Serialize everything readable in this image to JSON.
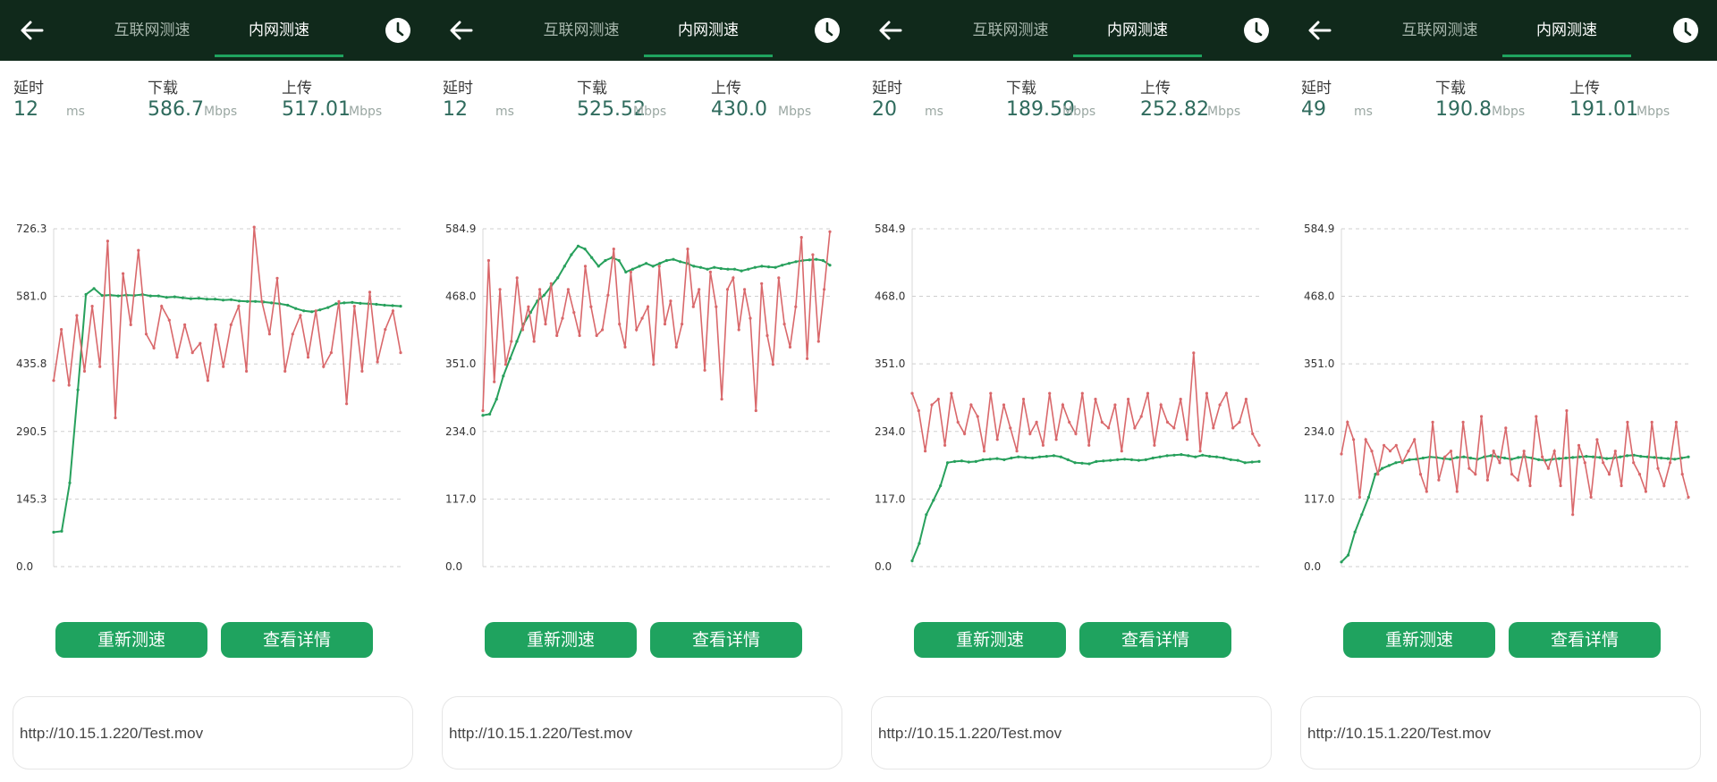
{
  "panels": [
    {
      "tabs": [
        "互联网测速",
        "内网测速"
      ],
      "latency": {
        "label": "延时",
        "value": "12",
        "unit": "ms"
      },
      "download": {
        "label": "下载",
        "value": "586.7",
        "unit": "Mbps"
      },
      "upload": {
        "label": "上传",
        "value": "517.01",
        "unit": "Mbps"
      },
      "retest_label": "重新测速",
      "details_label": "查看详情",
      "url": "http://10.15.1.220/Test.mov"
    },
    {
      "tabs": [
        "互联网测速",
        "内网测速"
      ],
      "latency": {
        "label": "延时",
        "value": "12",
        "unit": "ms"
      },
      "download": {
        "label": "下载",
        "value": "525.52",
        "unit": "Mbps"
      },
      "upload": {
        "label": "上传",
        "value": "430.0",
        "unit": "Mbps"
      },
      "retest_label": "重新测速",
      "details_label": "查看详情",
      "url": "http://10.15.1.220/Test.mov"
    },
    {
      "tabs": [
        "互联网测速",
        "内网测速"
      ],
      "latency": {
        "label": "延时",
        "value": "20",
        "unit": "ms"
      },
      "download": {
        "label": "下载",
        "value": "189.59",
        "unit": "Mbps"
      },
      "upload": {
        "label": "上传",
        "value": "252.82",
        "unit": "Mbps"
      },
      "retest_label": "重新测速",
      "details_label": "查看详情",
      "url": "http://10.15.1.220/Test.mov"
    },
    {
      "tabs": [
        "互联网测速",
        "内网测速"
      ],
      "latency": {
        "label": "延时",
        "value": "49",
        "unit": "ms"
      },
      "download": {
        "label": "下载",
        "value": "190.8",
        "unit": "Mbps"
      },
      "upload": {
        "label": "上传",
        "value": "191.01",
        "unit": "Mbps"
      },
      "retest_label": "重新测速",
      "details_label": "查看详情",
      "url": "http://10.15.1.220/Test.mov"
    }
  ],
  "icons": {
    "back": "arrow-left-icon",
    "history": "clock-icon"
  },
  "colors": {
    "topbar": "#10291b",
    "accent": "#1fa35f",
    "download_line": "#27a05c",
    "upload_line": "#d9686b"
  },
  "chart_data": [
    {
      "type": "line",
      "yticks": [
        "726.3",
        "581.0",
        "435.8",
        "290.5",
        "145.3",
        "0.0"
      ],
      "ylim": [
        0,
        726.3
      ],
      "grid": true,
      "series": [
        {
          "values": [
            74,
            76,
            180,
            380,
            585,
            598,
            583,
            584,
            582,
            584,
            583,
            585,
            582,
            582,
            579,
            580,
            578,
            576,
            577,
            575,
            575,
            573,
            574,
            571,
            570,
            570,
            569,
            567,
            565,
            562,
            555,
            550,
            548,
            552,
            557,
            565,
            567,
            568,
            566,
            565,
            564,
            562,
            561,
            560
          ]
        },
        {
          "values": [
            400,
            510,
            390,
            540,
            420,
            560,
            430,
            700,
            320,
            630,
            520,
            680,
            500,
            470,
            560,
            530,
            450,
            520,
            460,
            480,
            400,
            520,
            430,
            520,
            560,
            420,
            730,
            570,
            500,
            620,
            420,
            500,
            540,
            450,
            550,
            430,
            460,
            570,
            350,
            560,
            420,
            590,
            440,
            510,
            550,
            460
          ]
        }
      ]
    },
    {
      "type": "line",
      "yticks": [
        "584.9",
        "468.0",
        "351.0",
        "234.0",
        "117.0",
        "0.0"
      ],
      "ylim": [
        0,
        584.9
      ],
      "grid": true,
      "series": [
        {
          "values": [
            262,
            264,
            290,
            330,
            360,
            390,
            420,
            440,
            460,
            470,
            485,
            500,
            520,
            540,
            555,
            550,
            535,
            520,
            530,
            535,
            530,
            510,
            515,
            520,
            525,
            520,
            525,
            530,
            532,
            528,
            525,
            520,
            518,
            515,
            518,
            516,
            515,
            515,
            512,
            515,
            518,
            520,
            519,
            518,
            522,
            525,
            528,
            530,
            531,
            532,
            530,
            522
          ]
        },
        {
          "values": [
            270,
            530,
            320,
            480,
            350,
            390,
            500,
            410,
            450,
            390,
            480,
            420,
            490,
            400,
            430,
            480,
            440,
            400,
            520,
            450,
            400,
            410,
            470,
            550,
            420,
            380,
            510,
            410,
            430,
            450,
            350,
            520,
            420,
            460,
            380,
            420,
            550,
            450,
            480,
            340,
            510,
            450,
            290,
            480,
            500,
            410,
            480,
            430,
            270,
            490,
            400,
            350,
            500,
            420,
            380,
            450,
            570,
            360,
            540,
            390,
            480,
            580
          ]
        }
      ]
    },
    {
      "type": "line",
      "yticks": [
        "584.9",
        "468.0",
        "351.0",
        "234.0",
        "117.0",
        "0.0"
      ],
      "ylim": [
        0,
        584.9
      ],
      "grid": true,
      "series": [
        {
          "values": [
            10,
            40,
            90,
            115,
            140,
            180,
            182,
            183,
            181,
            182,
            185,
            186,
            187,
            185,
            188,
            190,
            189,
            188,
            190,
            191,
            192,
            190,
            185,
            180,
            179,
            178,
            182,
            183,
            184,
            185,
            186,
            185,
            184,
            185,
            188,
            190,
            192,
            193,
            194,
            192,
            190,
            193,
            191,
            190,
            188,
            185,
            184,
            180,
            181,
            182
          ]
        },
        {
          "values": [
            300,
            270,
            200,
            280,
            290,
            210,
            300,
            250,
            230,
            280,
            260,
            200,
            300,
            220,
            280,
            240,
            200,
            290,
            230,
            250,
            210,
            300,
            220,
            280,
            250,
            230,
            300,
            210,
            290,
            250,
            240,
            280,
            200,
            290,
            240,
            260,
            300,
            210,
            280,
            250,
            240,
            290,
            220,
            370,
            200,
            300,
            240,
            280,
            300,
            240,
            250,
            290,
            230,
            210
          ]
        }
      ]
    },
    {
      "type": "line",
      "yticks": [
        "584.9",
        "468.0",
        "351.0",
        "234.0",
        "117.0",
        "0.0"
      ],
      "ylim": [
        0,
        584.9
      ],
      "grid": true,
      "series": [
        {
          "values": [
            8,
            20,
            60,
            90,
            120,
            160,
            170,
            175,
            180,
            182,
            185,
            186,
            188,
            190,
            189,
            187,
            186,
            189,
            190,
            188,
            186,
            190,
            192,
            190,
            188,
            186,
            189,
            190,
            188,
            185,
            184,
            186,
            187,
            188,
            189,
            190,
            191,
            190,
            189,
            187,
            188,
            190,
            192,
            193,
            191,
            190,
            189,
            188,
            187,
            186,
            188,
            190
          ]
        },
        {
          "values": [
            195,
            250,
            220,
            120,
            220,
            200,
            160,
            210,
            200,
            210,
            180,
            200,
            220,
            160,
            130,
            250,
            150,
            190,
            200,
            130,
            250,
            170,
            160,
            260,
            150,
            200,
            180,
            240,
            160,
            150,
            200,
            140,
            260,
            190,
            170,
            200,
            140,
            270,
            90,
            210,
            180,
            120,
            220,
            180,
            160,
            200,
            140,
            250,
            180,
            160,
            130,
            250,
            170,
            140,
            180,
            250,
            160,
            120
          ]
        }
      ]
    }
  ]
}
